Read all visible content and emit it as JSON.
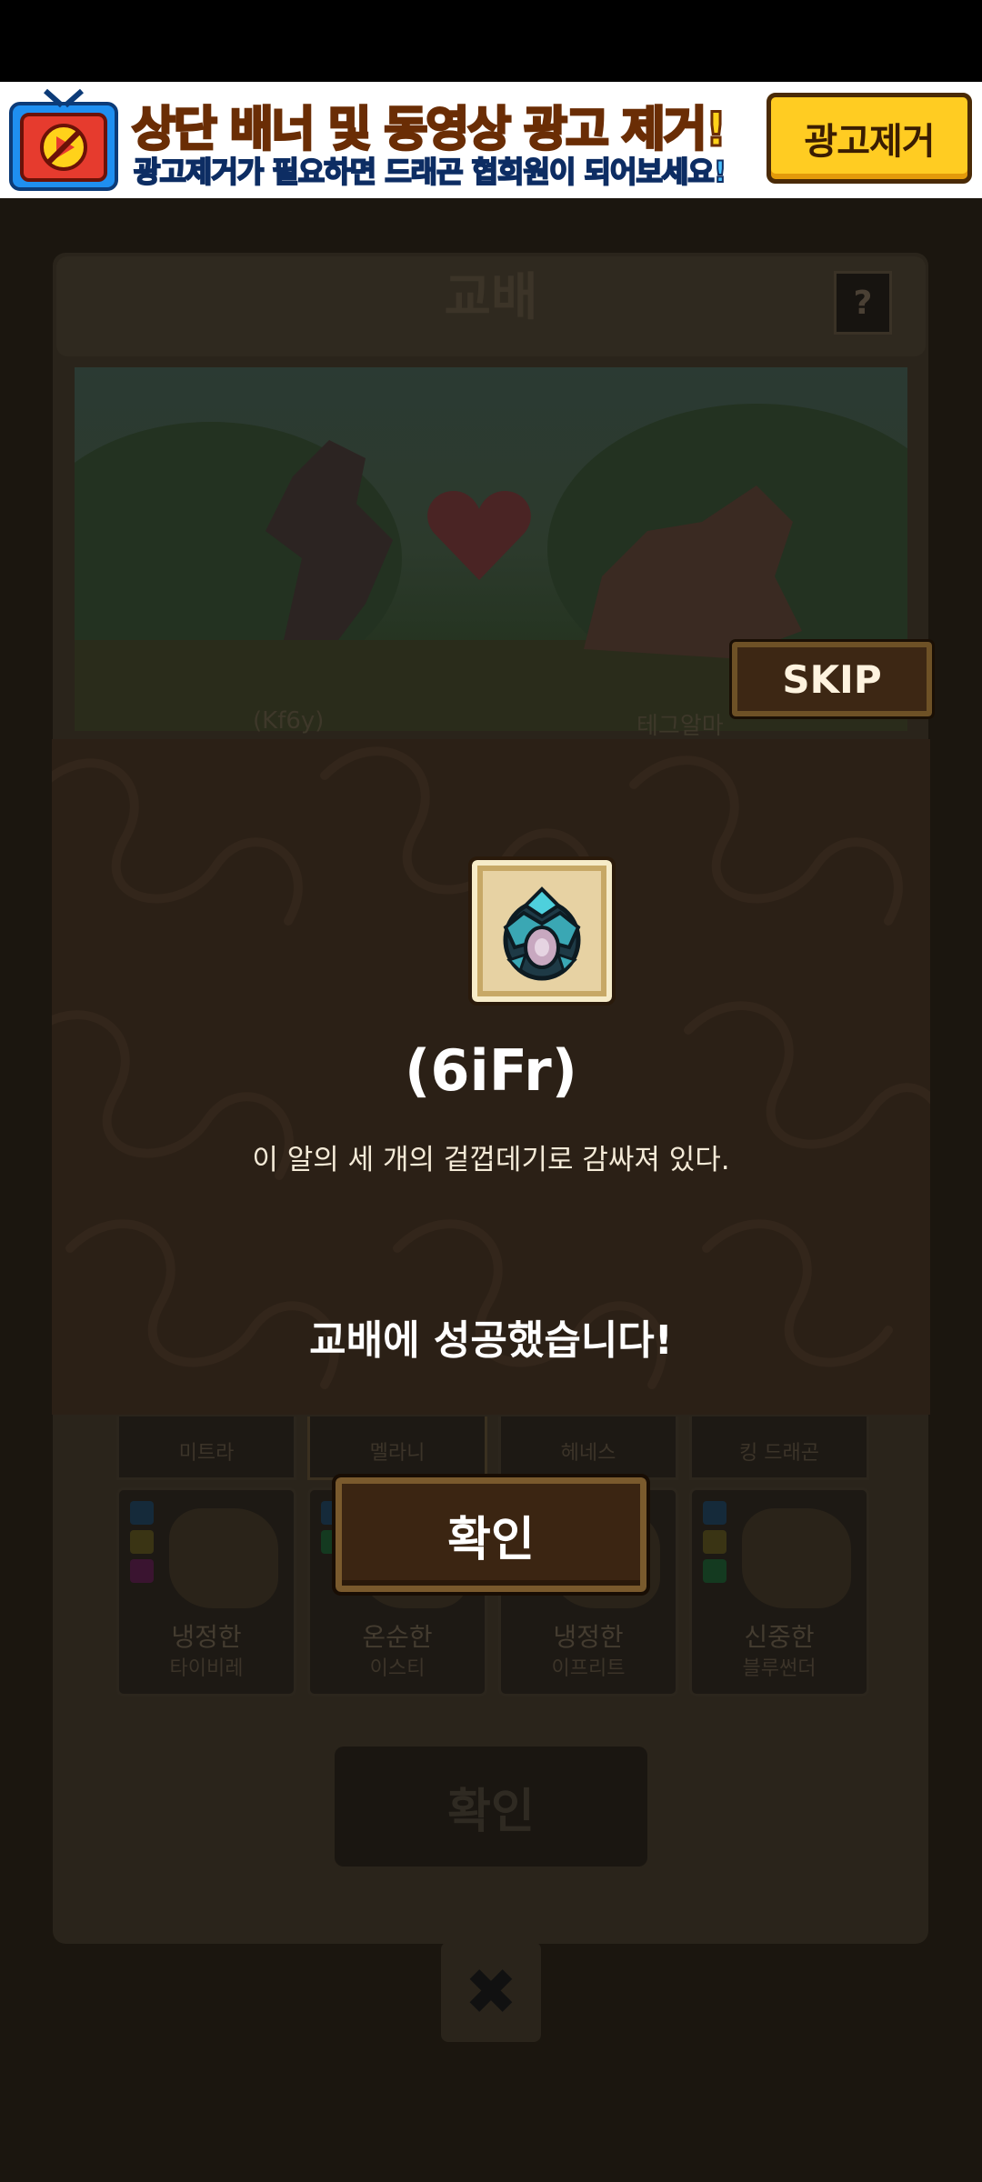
{
  "ad": {
    "title": "상단 배너 및 동영상 광고 제거!",
    "subtitle": "광고제거가 필요하면 드래곤 협회원이 되어보세요!",
    "remove_button": "광고제거"
  },
  "background": {
    "title": "교배",
    "help": "?",
    "parent_left": "(Kf6y)",
    "parent_right": "테그알마",
    "cards_row1": [
      {
        "name": "미트라"
      },
      {
        "name": "멜라니"
      },
      {
        "name": "헤네스"
      },
      {
        "name": "킹 드래곤"
      }
    ],
    "cards_row2": [
      {
        "trait": "냉정한",
        "name": "타이비레"
      },
      {
        "trait": "온순한",
        "name": "이스티"
      },
      {
        "trait": "냉정한",
        "name": "이프리트"
      },
      {
        "trait": "신중한",
        "name": "블루썬더"
      }
    ],
    "confirm": "확인",
    "close": "✖"
  },
  "skip_label": "SKIP",
  "result": {
    "item_code": "(6iFr)",
    "description": "이 알의 세 개의 겉껍데기로 감싸져 있다.",
    "message": "교배에 성공했습니다!",
    "confirm_label": "확인"
  }
}
